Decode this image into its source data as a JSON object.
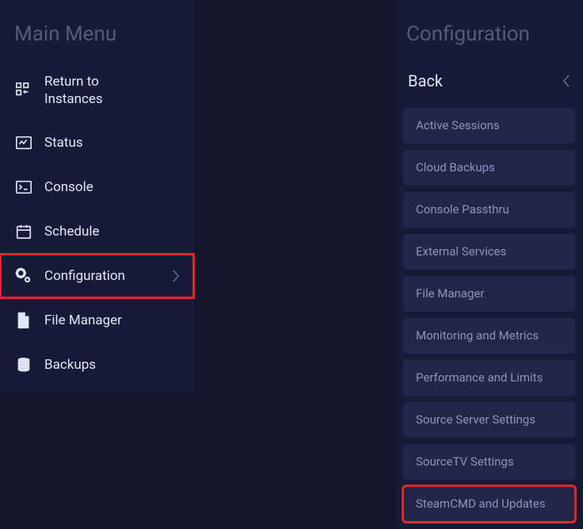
{
  "sidebar": {
    "title": "Main Menu",
    "items": [
      {
        "label": "Return to Instances",
        "icon": "instances"
      },
      {
        "label": "Status",
        "icon": "status"
      },
      {
        "label": "Console",
        "icon": "console"
      },
      {
        "label": "Schedule",
        "icon": "schedule"
      },
      {
        "label": "Configuration",
        "icon": "cogs",
        "chevron": true,
        "highlighted": true
      },
      {
        "label": "File Manager",
        "icon": "file"
      },
      {
        "label": "Backups",
        "icon": "stack"
      }
    ]
  },
  "panel": {
    "title": "Configuration",
    "back": "Back",
    "items": [
      {
        "label": "Active Sessions"
      },
      {
        "label": "Cloud Backups"
      },
      {
        "label": "Console Passthru"
      },
      {
        "label": "External Services"
      },
      {
        "label": "File Manager"
      },
      {
        "label": "Monitoring and Metrics"
      },
      {
        "label": "Performance and Limits"
      },
      {
        "label": "Source Server Settings"
      },
      {
        "label": "SourceTV Settings"
      },
      {
        "label": "SteamCMD and Updates",
        "highlighted": true
      }
    ]
  }
}
